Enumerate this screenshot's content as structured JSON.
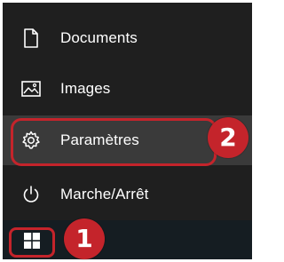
{
  "start_menu": {
    "items": [
      {
        "label": "Documents",
        "icon": "document-icon"
      },
      {
        "label": "Images",
        "icon": "image-icon"
      },
      {
        "label": "Paramètres",
        "icon": "gear-icon",
        "highlighted": true
      },
      {
        "label": "Marche/Arrêt",
        "icon": "power-icon"
      }
    ]
  },
  "taskbar": {
    "start_icon": "windows-logo-icon"
  },
  "annotations": {
    "step_1": "1",
    "step_2": "2",
    "color": "#c4242b"
  }
}
